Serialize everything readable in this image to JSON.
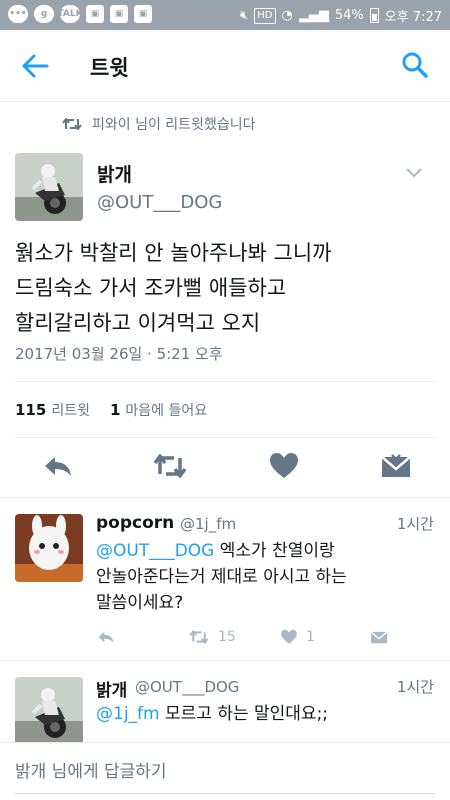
{
  "status_bar": {
    "left_icons": [
      "chat-bubble-icon",
      "g-app-icon",
      "talk-icon",
      "image-icon",
      "image-icon",
      "image-icon"
    ],
    "hd": "HD",
    "battery": "54%",
    "time": "오후 7:27"
  },
  "header": {
    "title": "트윗"
  },
  "retweet_context": "피와이 님이 리트윗했습니다",
  "main_tweet": {
    "name": "밝개",
    "handle": "@OUT___DOG",
    "text_lines": [
      "웕소가 박찰리 안 놀아주나봐 그니까",
      "드림숙소 가서 조카뻘 애들하고",
      "할리갈리하고 이겨먹고 오지"
    ],
    "date": "2017년 03월 26일 · 5:21 오후",
    "retweets_count": "115",
    "retweets_label": "리트윗",
    "likes_count": "1",
    "likes_label": "마음에 들어요"
  },
  "replies": [
    {
      "name": "popcorn",
      "handle": "@1j_fm",
      "time": "1시간",
      "mention": "@OUT___DOG",
      "text_lines": [
        " 엑소가 찬열이랑",
        "안놀아준다는거 제대로 아시고 하는",
        "말씀이세요?"
      ],
      "retweets": "15",
      "likes": "1"
    },
    {
      "name": "밝개",
      "handle": "@OUT___DOG",
      "time": "1시간",
      "mention": "@1j_fm",
      "text_lines": [
        " 모르고 하는 말인대요;;"
      ]
    }
  ],
  "reply_box": {
    "placeholder": "밝개 님에게 답글하기"
  },
  "colors": {
    "accent": "#1da1f2",
    "muted": "#657786",
    "icon": "#657786",
    "status_bar": "#9aa3ab"
  }
}
